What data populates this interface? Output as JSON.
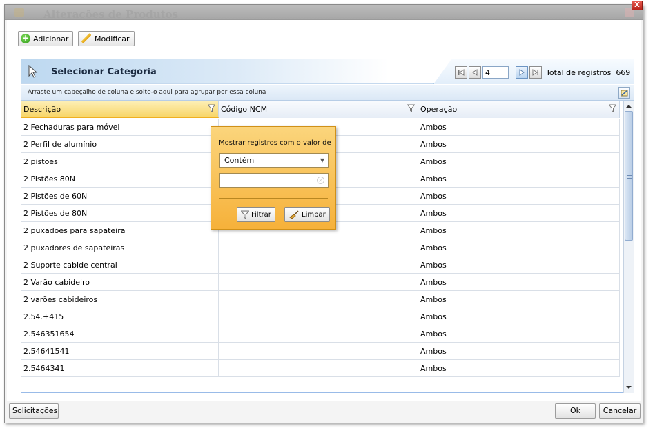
{
  "window": {
    "title": "Alterações de Produtos",
    "close_label": "X"
  },
  "toolbar": {
    "add_label": "Adicionar",
    "edit_label": "Modificar"
  },
  "panel": {
    "title": "Selecionar Categoria",
    "group_hint": "Arraste um cabeçalho de coluna e solte-o aqui para agrupar por essa coluna"
  },
  "pager": {
    "current_page": "4",
    "total_label": "Total de registros",
    "total_value": "669"
  },
  "grid": {
    "columns": [
      "Descrição",
      "Código NCM",
      "Operação"
    ],
    "rows": [
      {
        "descricao": "2 Fechaduras para móvel",
        "ncm": "",
        "operacao": "Ambos"
      },
      {
        "descricao": "2 Perfil de alumínio",
        "ncm": "",
        "operacao": "Ambos"
      },
      {
        "descricao": "2 pistoes",
        "ncm": "",
        "operacao": "Ambos"
      },
      {
        "descricao": "2 Pistões 80N",
        "ncm": "",
        "operacao": "Ambos"
      },
      {
        "descricao": "2 Pistões de 60N",
        "ncm": "",
        "operacao": "Ambos"
      },
      {
        "descricao": "2 Pistões de 80N",
        "ncm": "",
        "operacao": "Ambos"
      },
      {
        "descricao": "2 puxadoes para sapateira",
        "ncm": "",
        "operacao": "Ambos"
      },
      {
        "descricao": "2 puxadores de sapateiras",
        "ncm": "",
        "operacao": "Ambos"
      },
      {
        "descricao": "2 Suporte cabide central",
        "ncm": "",
        "operacao": "Ambos"
      },
      {
        "descricao": "2 Varão cabideiro",
        "ncm": "",
        "operacao": "Ambos"
      },
      {
        "descricao": "2 varões cabideiros",
        "ncm": "",
        "operacao": "Ambos"
      },
      {
        "descricao": "2.54.+415",
        "ncm": "",
        "operacao": "Ambos"
      },
      {
        "descricao": "2.546351654",
        "ncm": "",
        "operacao": "Ambos"
      },
      {
        "descricao": "2.54641541",
        "ncm": "",
        "operacao": "Ambos"
      },
      {
        "descricao": "2.5464341",
        "ncm": "",
        "operacao": "Ambos"
      }
    ]
  },
  "filter_popup": {
    "title": "Mostrar registros com o valor de",
    "operator": "Contém",
    "value": "",
    "filter_label": "Filtrar",
    "clear_label": "Limpar"
  },
  "footer": {
    "requests_label": "Solicitações",
    "ok_label": "Ok",
    "cancel_label": "Cancelar"
  },
  "colors": {
    "accent": "#99bbe8",
    "popup": "#f6b13a",
    "sorted_header": "#f8d66a"
  }
}
